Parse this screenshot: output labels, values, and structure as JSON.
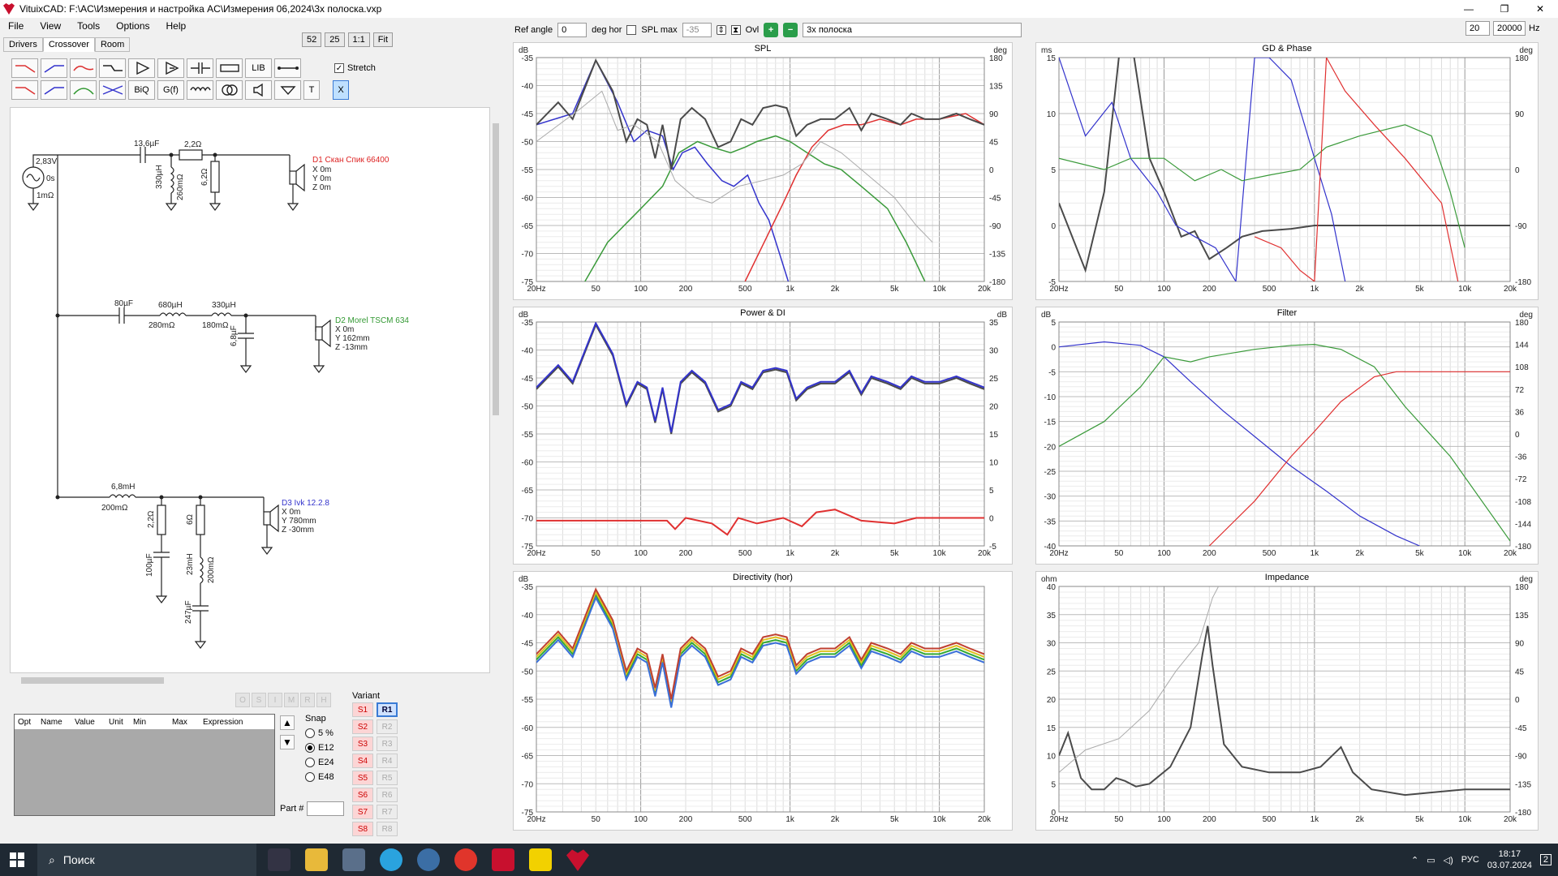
{
  "window": {
    "title": "VituixCAD: F:\\AC\\Измерения и настройка AC\\Измерения 06,2024\\3х полоска.vxp"
  },
  "menu": [
    "File",
    "View",
    "Tools",
    "Options",
    "Help"
  ],
  "tabs": [
    "Drivers",
    "Crossover",
    "Room"
  ],
  "zoom": [
    "52",
    "25",
    "1:1",
    "Fit"
  ],
  "toolbar": {
    "lib": "LIB",
    "biq": "BiQ",
    "gf": "G(f)",
    "t": "T",
    "x": "X",
    "stretch": "Stretch"
  },
  "schematic": {
    "source": {
      "voltage": "2,83V",
      "delay": "0s",
      "resistance": "1mΩ"
    },
    "d1": {
      "name": "D1 Скан Спик 66400",
      "x": "X 0m",
      "y": "Y 0m",
      "z": "Z 0m"
    },
    "d2": {
      "name": "D2 Morel TSCM 634",
      "x": "X 0m",
      "y": "Y 162mm",
      "z": "Z -13mm"
    },
    "d3": {
      "name": "D3 Ivk 12.2.8",
      "x": "X 0m",
      "y": "Y 780mm",
      "z": "Z -30mm"
    },
    "parts": {
      "c1": "13,6µF",
      "r1": "2,2Ω",
      "l1": "330µH",
      "l1r": "260mΩ",
      "r2": "6,2Ω",
      "c2": "80µF",
      "l2": "680µH",
      "l2r": "280mΩ",
      "l3": "330µH",
      "l3r": "180mΩ",
      "c3": "6,8µF",
      "l4": "6,8mH",
      "l4r": "200mΩ",
      "r3": "2,2Ω",
      "c4": "100µF",
      "r4": "6Ω",
      "l5": "23mH",
      "l5r": "200mΩ",
      "c5": "247µF"
    }
  },
  "opt_buttons": [
    "O",
    "S",
    "I",
    "M",
    "R",
    "H"
  ],
  "opt_table_headers": [
    "Opt",
    "Name",
    "Value",
    "Unit",
    "Min",
    "Max",
    "Expression"
  ],
  "snap": {
    "label": "Snap",
    "options": [
      "5 %",
      "E12",
      "E24",
      "E48"
    ],
    "selected": "E12"
  },
  "part_label": "Part #",
  "variant": {
    "label": "Variant",
    "s": [
      "S1",
      "S2",
      "S3",
      "S4",
      "S5",
      "S6",
      "S7",
      "S8"
    ],
    "r": [
      "R1",
      "R2",
      "R3",
      "R4",
      "R5",
      "R6",
      "R7",
      "R8"
    ],
    "selected": "R1"
  },
  "top": {
    "ref_angle_label": "Ref angle",
    "ref_angle": "0",
    "deg_hor": "deg hor",
    "spl_max_label": "SPL max",
    "spl_max": "-35",
    "ovl": "Ovl",
    "overlay_name": "3х полоска",
    "freq_min": "20",
    "freq_max": "20000",
    "hz": "Hz"
  },
  "xticks": [
    "20Hz",
    "50",
    "100",
    "200",
    "500",
    "1k",
    "2k",
    "5k",
    "10k",
    "20k"
  ],
  "colors": {
    "dark": "#4a4a4a",
    "blue": "#3333cc",
    "green": "#3a9a3a",
    "red": "#e03030",
    "grey": "#aaaaaa"
  },
  "graphs": {
    "spl": {
      "title": "SPL",
      "left_unit": "dB",
      "right_unit": "deg",
      "yl": [
        "-35",
        "-40",
        "-45",
        "-50",
        "-55",
        "-60",
        "-65",
        "-70",
        "-75"
      ],
      "yr": [
        "180",
        "135",
        "90",
        "45",
        "0",
        "-45",
        "-90",
        "-135",
        "-180"
      ]
    },
    "gd": {
      "title": "GD & Phase",
      "left_unit": "ms",
      "right_unit": "deg",
      "yl": [
        "15",
        "10",
        "5",
        "0",
        "-5"
      ],
      "yr": [
        "180",
        "90",
        "0",
        "-90",
        "-180"
      ]
    },
    "power": {
      "title": "Power & DI",
      "left_unit": "dB",
      "right_unit": "dB",
      "yl": [
        "-35",
        "-40",
        "-45",
        "-50",
        "-55",
        "-60",
        "-65",
        "-70",
        "-75"
      ],
      "yr": [
        "35",
        "30",
        "25",
        "20",
        "15",
        "10",
        "5",
        "0",
        "-5"
      ]
    },
    "filter": {
      "title": "Filter",
      "left_unit": "dB",
      "right_unit": "deg",
      "yl": [
        "5",
        "0",
        "-5",
        "-10",
        "-15",
        "-20",
        "-25",
        "-30",
        "-35",
        "-40"
      ],
      "yr": [
        "180",
        "144",
        "108",
        "72",
        "36",
        "0",
        "-36",
        "-72",
        "-108",
        "-144",
        "-180"
      ]
    },
    "directivity": {
      "title": "Directivity (hor)",
      "left_unit": "dB",
      "right_unit": "",
      "yl": [
        "-35",
        "-40",
        "-45",
        "-50",
        "-55",
        "-60",
        "-65",
        "-70",
        "-75"
      ],
      "yr": []
    },
    "impedance": {
      "title": "Impedance",
      "left_unit": "ohm",
      "right_unit": "deg",
      "yl": [
        "40",
        "35",
        "30",
        "25",
        "20",
        "15",
        "10",
        "5",
        "0"
      ],
      "yr": [
        "180",
        "135",
        "90",
        "45",
        "0",
        "-45",
        "-90",
        "-135",
        "-180"
      ]
    }
  },
  "taskbar": {
    "search": "Поиск",
    "lang": "РУС",
    "time": "18:17",
    "date": "03.07.2024",
    "badge": "2"
  }
}
